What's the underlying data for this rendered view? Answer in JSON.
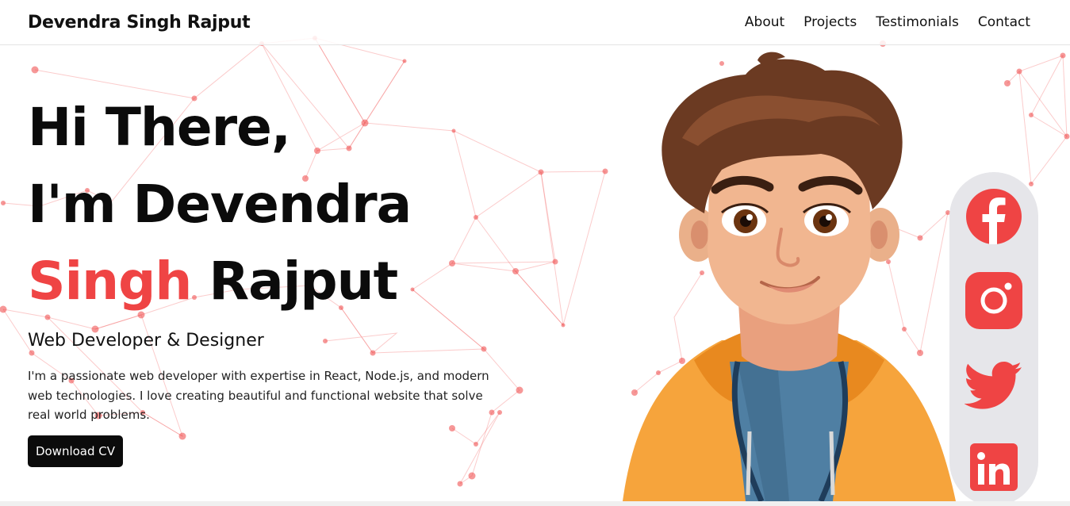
{
  "navbar": {
    "brand": "Devendra Singh Rajput",
    "links": [
      "About",
      "Projects",
      "Testimonials",
      "Contact"
    ]
  },
  "hero": {
    "line1": "Hi There,",
    "line2": "I'm Devendra",
    "line3_accent": "Singh",
    "line3_rest": " Rajput",
    "subtitle": "Web Developer & Designer",
    "description": "I'm a passionate web developer with expertise in React, Node.js, and modern web technologies. I love creating beautiful and functional website that solve real world problems.",
    "cta_label": "Download CV"
  },
  "social": {
    "items": [
      "facebook-icon",
      "instagram-icon",
      "twitter-icon",
      "linkedin-icon"
    ]
  },
  "colors": {
    "accent": "#ef4444",
    "text": "#0b0b0b",
    "button_bg": "#0b0b0b",
    "social_panel": "#e6e6ea"
  }
}
